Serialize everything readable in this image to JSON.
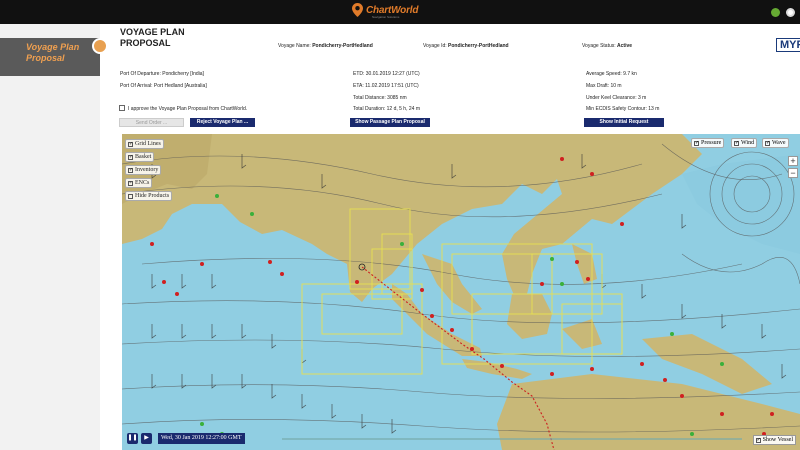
{
  "header": {
    "logo_text": "ChartWorld",
    "logo_sub": "Navigation Solutions"
  },
  "sidebar": {
    "selected_label": "Voyage Plan Proposal"
  },
  "main": {
    "title_line1": "VOYAGE PLAN",
    "title_line2": "PROPOSAL",
    "voyage_name_label": "Voyage Name:",
    "voyage_name": "Pondicherry-PortHedland",
    "voyage_id_label": "Voyage Id:",
    "voyage_id": "Pondicherry-PortHedland",
    "voyage_status_label": "Voyage Status:",
    "voyage_status": "Active",
    "brand": "MYP",
    "departure": "Port Of Departure: Pondicherry [India]",
    "arrival": "Port Of Arrival: Port Hedland [Australia]",
    "etd": "ETD: 30.01.2019 12:27 (UTC)",
    "eta": "ETA: 11.02.2019 17:51 (UTC)",
    "total_distance": "Total Distance: 3085 nm",
    "total_duration": "Total Duration: 12 d, 5 h, 24 m",
    "avg_speed": "Average Speed: 9.7 kn",
    "max_draft": "Max Draft: 10 m",
    "ukc": "Under Keel Clearance: 3 m",
    "safety_contour": "Min ECDIS Safety Contour: 13 m",
    "approve_text": "I approve the Voyage Plan Proposal from ChartWorld.",
    "send_order_label": "Send Order ...",
    "reject_label": "Reject Voyage Plan ...",
    "passage_label": "Show Passage Plan Proposal",
    "initial_request_label": "Show Initial Request"
  },
  "map": {
    "layers": [
      "Grid Lines",
      "Basket",
      "Inventory",
      "ENCs",
      "Hide Products"
    ],
    "toggles": [
      "Pressure",
      "Wind",
      "Wave"
    ],
    "timestamp": "Wed, 30 Jan 2019 12:27:00 GMT",
    "show_vessel": "Show Vessel",
    "colors": {
      "land": "#c8b878",
      "sea": "#8ccbe0",
      "isobar": "#555555",
      "route": "#cc2020",
      "enc": "#e8e050"
    }
  }
}
